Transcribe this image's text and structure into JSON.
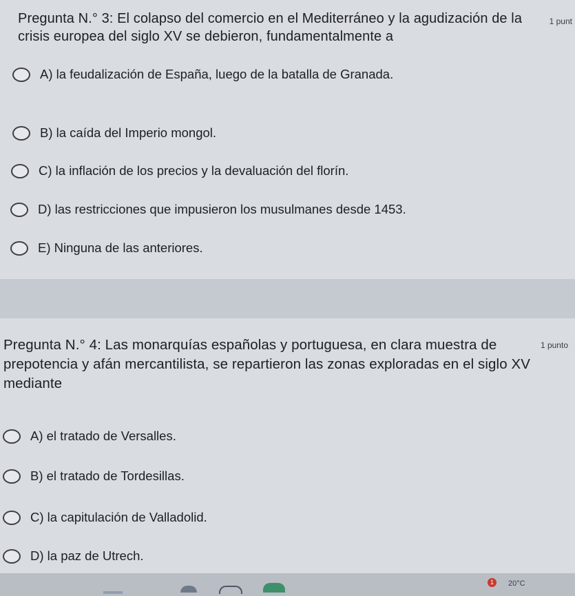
{
  "questions": [
    {
      "title": "Pregunta N.° 3: El colapso del comercio en el Mediterráneo y la agudización de la crisis europea del siglo XV se debieron, fundamentalmente a",
      "points": "1 punt",
      "options": [
        "A) la feudalización de España, luego de la batalla de Granada.",
        "B) la caída del Imperio mongol.",
        "C) la inflación de los precios y la devaluación del florín.",
        "D) las restricciones que impusieron los musulmanes desde 1453.",
        "E) Ninguna de las anteriores."
      ]
    },
    {
      "title": "Pregunta N.° 4: Las monarquías españolas y portuguesa, en clara muestra de prepotencia y afán mercantilista, se repartieron las zonas exploradas en el siglo XV mediante",
      "points": "1 punto",
      "options": [
        "A) el tratado de Versalles.",
        "B) el tratado de Tordesillas.",
        "C) la capitulación de Valladolid.",
        "D) la paz de Utrech."
      ]
    }
  ],
  "taskbar": {
    "notification_count": "1",
    "temperature": "20°C"
  }
}
